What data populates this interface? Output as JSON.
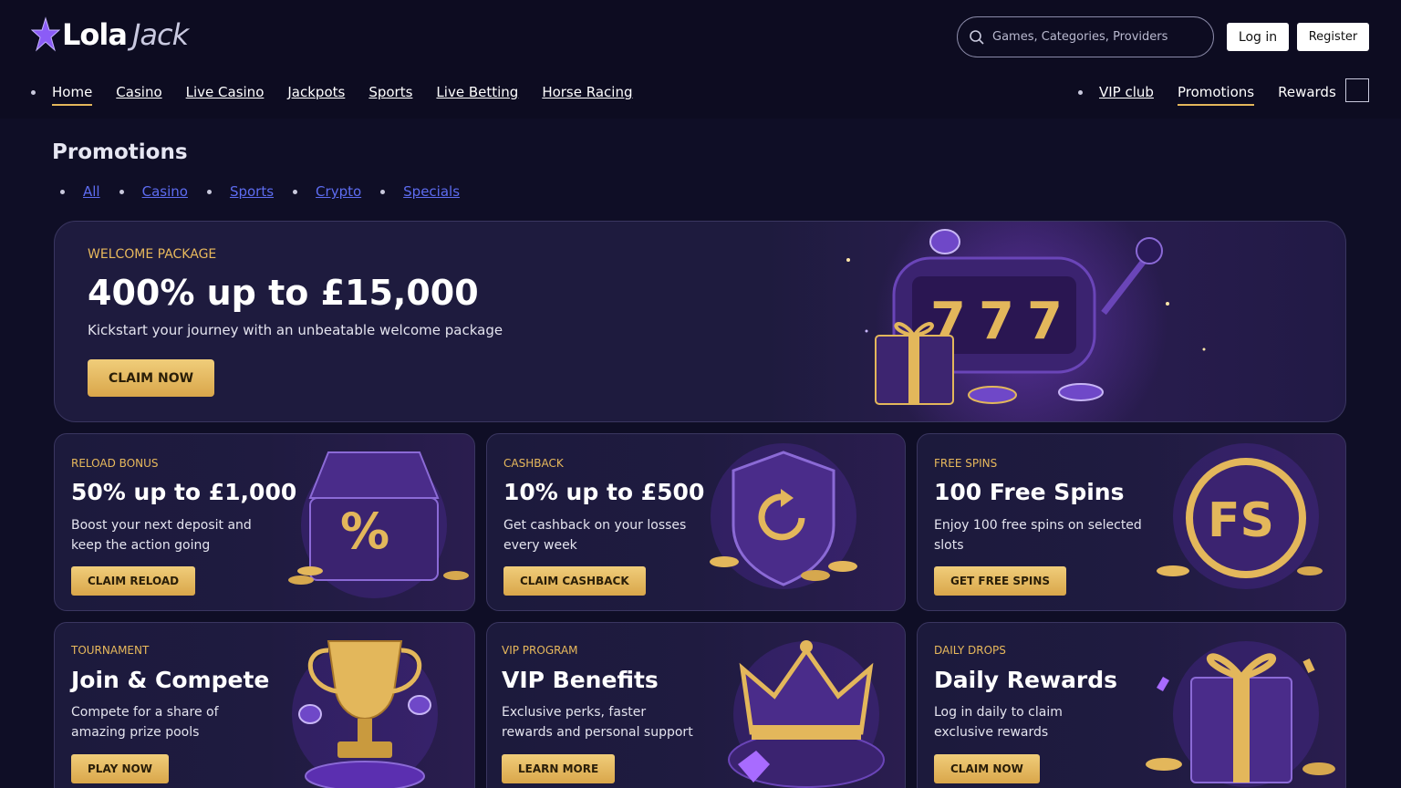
{
  "brand": {
    "name_part1": "Lola",
    "name_part2": "Jack",
    "star_color": "#8b5cf6"
  },
  "search": {
    "placeholder": "Games, Categories, Providers"
  },
  "auth": {
    "login_label": "Log in",
    "register_label": "Register"
  },
  "nav": {
    "left": [
      "Home",
      "Casino",
      "Live Casino",
      "Jackpots",
      "Sports",
      "Live Betting",
      "Horse Racing"
    ],
    "left_active": "Home",
    "right": [
      "VIP club",
      "Promotions",
      "Rewards"
    ],
    "right_active": "Promotions"
  },
  "page": {
    "title": "Promotions"
  },
  "filters": [
    "All",
    "Casino",
    "Sports",
    "Crypto",
    "Specials"
  ],
  "hero": {
    "eyebrow": "WELCOME PACKAGE",
    "title": "400% up to £15,000",
    "subtitle": "Kickstart your journey with an unbeatable welcome package",
    "button": "CLAIM NOW",
    "art_icon": "slot-machine-777-icon"
  },
  "cards": [
    {
      "eyebrow": "RELOAD BONUS",
      "title": "50% up to £1,000",
      "subtitle": "Boost your next deposit and keep the action going",
      "button": "CLAIM RELOAD",
      "icon": "treasure-chest-icon"
    },
    {
      "eyebrow": "CASHBACK",
      "title": "10% up to £500",
      "subtitle": "Get cashback on your losses every week",
      "button": "CLAIM CASHBACK",
      "icon": "shield-cashback-icon"
    },
    {
      "eyebrow": "FREE SPINS",
      "title": "100 Free Spins",
      "subtitle": "Enjoy 100 free spins on selected slots",
      "button": "GET FREE SPINS",
      "icon": "fs-coin-icon"
    },
    {
      "eyebrow": "TOURNAMENT",
      "title": "Join & Compete",
      "subtitle": "Compete for a share of amazing prize pools",
      "button": "PLAY NOW",
      "icon": "trophy-icon"
    },
    {
      "eyebrow": "VIP PROGRAM",
      "title": "VIP Benefits",
      "subtitle": "Exclusive perks, faster rewards and personal support",
      "button": "LEARN MORE",
      "icon": "crown-icon"
    },
    {
      "eyebrow": "DAILY DROPS",
      "title": "Daily Rewards",
      "subtitle": "Log in daily to claim exclusive rewards",
      "button": "CLAIM NOW",
      "icon": "gift-box-icon"
    }
  ],
  "colors": {
    "accent_gold": "#e8b95c",
    "background": "#0f0e26",
    "card_border": "#3a3660",
    "link_blue": "#5d6cf0"
  }
}
